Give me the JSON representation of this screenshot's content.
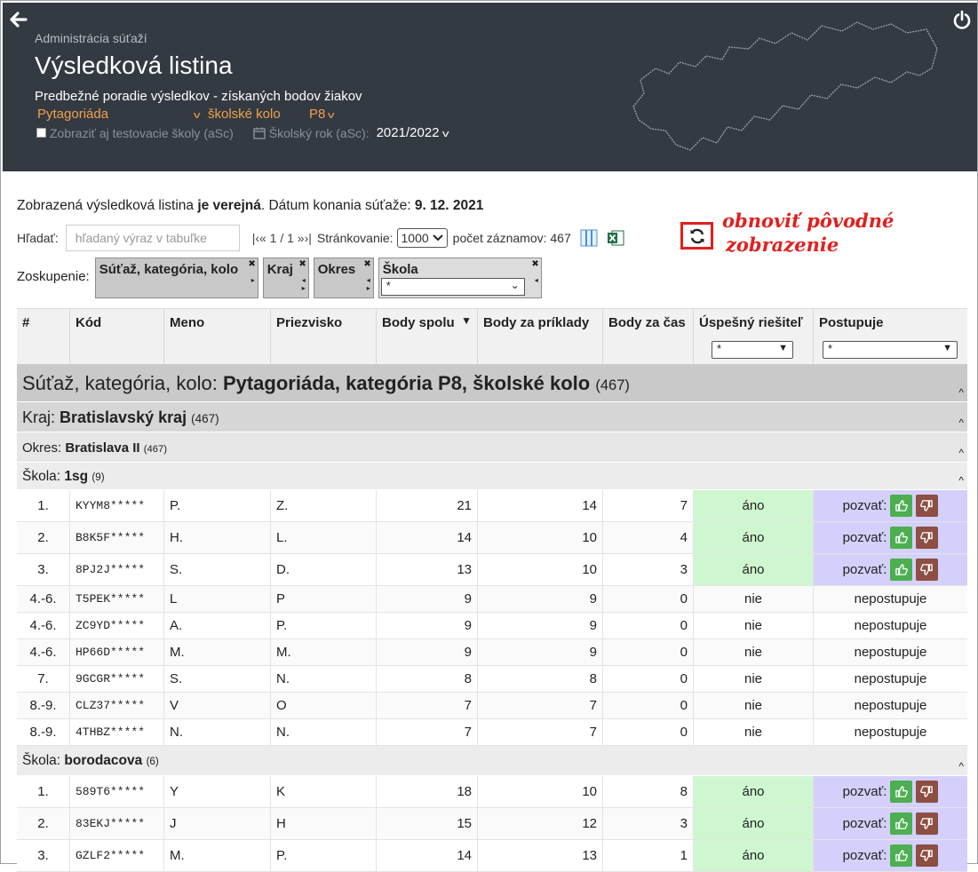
{
  "header": {
    "breadcrumb": "Administrácia súťaží",
    "title": "Výsledková listina",
    "subtitle": "Predbežné poradie výsledkov - získaných bodov žiakov",
    "competition": "Pytagoriáda",
    "round": "školské kolo",
    "category": "P8",
    "show_test_schools": "Zobraziť aj testovacie školy (aSc)",
    "school_year_label": "Školský rok (aSc):",
    "school_year": "2021/2022"
  },
  "info": {
    "prefix": "Zobrazená výsledková listina ",
    "public": "je verejná",
    "date_label": ". Dátum konania súťaže: ",
    "date": "9. 12. 2021"
  },
  "search": {
    "label": "Hľadať:",
    "placeholder": "hľadaný výraz v tabuľke",
    "pager": "|‹« 1 / 1 »›|",
    "paging_label": "Stránkovanie:",
    "paging_value": "1000",
    "records": "počet záznamov: 467"
  },
  "annotation": {
    "line1": "obnoviť pôvodné",
    "line2": "zobrazenie"
  },
  "grouping": {
    "label": "Zoskupenie:",
    "chips": [
      "Súťaž, kategória, kolo",
      "Kraj",
      "Okres",
      "Škola"
    ],
    "school_filter": "*"
  },
  "table": {
    "headers": [
      "#",
      "Kód",
      "Meno",
      "Priezvisko",
      "Body spolu",
      "Body za príklady",
      "Body za čas",
      "Úspešný riešiteľ",
      "Postupuje"
    ],
    "filter_successful": "*",
    "filter_advance": "*",
    "group_competition": {
      "label": "Súťaž, kategória, kolo: ",
      "value": "Pytagoriáda, kategória P8, školské kolo",
      "count": "(467)"
    },
    "group_region": {
      "label": "Kraj: ",
      "value": "Bratislavský kraj",
      "count": "(467)"
    },
    "group_district": {
      "label": "Okres: ",
      "value": "Bratislava II",
      "count": "(467)"
    },
    "school1": {
      "label": "Škola: ",
      "value": "1sg",
      "count": "(9)"
    },
    "rows1": [
      [
        "1.",
        "KYYM8*****",
        "P.",
        "Z.",
        "21",
        "14",
        "7",
        "áno",
        "pozvať:"
      ],
      [
        "2.",
        "B8K5F*****",
        "H.",
        "L.",
        "14",
        "10",
        "4",
        "áno",
        "pozvať:"
      ],
      [
        "3.",
        "8PJ2J*****",
        "S.",
        "D.",
        "13",
        "10",
        "3",
        "áno",
        "pozvať:"
      ],
      [
        "4.-6.",
        "T5PEK*****",
        "L",
        "P",
        "9",
        "9",
        "0",
        "nie",
        "nepostupuje"
      ],
      [
        "4.-6.",
        "ZC9YD*****",
        "A.",
        "P.",
        "9",
        "9",
        "0",
        "nie",
        "nepostupuje"
      ],
      [
        "4.-6.",
        "HP66D*****",
        "M.",
        "M.",
        "9",
        "9",
        "0",
        "nie",
        "nepostupuje"
      ],
      [
        "7.",
        "9GCGR*****",
        "S.",
        "N.",
        "8",
        "8",
        "0",
        "nie",
        "nepostupuje"
      ],
      [
        "8.-9.",
        "CLZ37*****",
        "V",
        "O",
        "7",
        "7",
        "0",
        "nie",
        "nepostupuje"
      ],
      [
        "8.-9.",
        "4THBZ*****",
        "N.",
        "N.",
        "7",
        "7",
        "0",
        "nie",
        "nepostupuje"
      ]
    ],
    "school2": {
      "label": "Škola: ",
      "value": "borodacova",
      "count": "(6)"
    },
    "rows2": [
      [
        "1.",
        "589T6*****",
        "Y",
        "K",
        "18",
        "10",
        "8",
        "áno",
        "pozvať:"
      ],
      [
        "2.",
        "83EKJ*****",
        "J",
        "H",
        "15",
        "12",
        "3",
        "áno",
        "pozvať:"
      ],
      [
        "3.",
        "GZLF2*****",
        "M.",
        "P.",
        "14",
        "13",
        "1",
        "áno",
        "pozvať:"
      ]
    ]
  },
  "colors": {
    "header_bg": "#343a42",
    "accent_orange": "#f0a04b",
    "annotation_red": "#e0201e",
    "yes_green": "#cff7cf",
    "yes_purple": "#d4d0fb"
  }
}
